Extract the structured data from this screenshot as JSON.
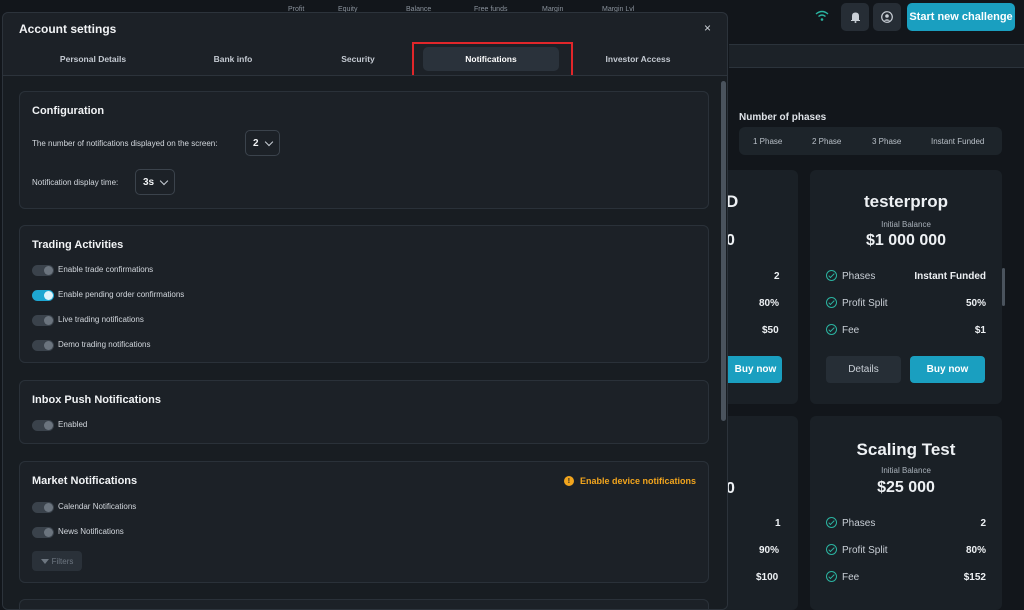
{
  "topbar": {
    "stats": [
      "Profit",
      "Equity",
      "Balance",
      "Free funds",
      "Margin",
      "Margin Lvl"
    ],
    "start_button": "Start new challenge",
    "icons": [
      "wifi-icon",
      "bell-icon",
      "user-icon"
    ]
  },
  "phases": {
    "title": "Number of phases",
    "tabs": [
      "1 Phase",
      "2 Phase",
      "3 Phase",
      "Instant Funded"
    ]
  },
  "cards": [
    {
      "title": "testerprop",
      "subtitle": "Initial Balance",
      "amount": "$1 000 000",
      "rows": [
        {
          "label": "Phases",
          "value": "Instant Funded"
        },
        {
          "label": "Profit Split",
          "value": "50%"
        },
        {
          "label": "Fee",
          "value": "$1"
        }
      ],
      "details_label": "Details",
      "buy_label": "Buy now"
    },
    {
      "title": "Scaling Test",
      "subtitle": "Initial Balance",
      "amount": "$25 000",
      "rows": [
        {
          "label": "Phases",
          "value": "2"
        },
        {
          "label": "Profit Split",
          "value": "80%"
        },
        {
          "label": "Fee",
          "value": "$152"
        }
      ]
    }
  ],
  "left_cards": {
    "top_values": [
      "2",
      "80%",
      "$50"
    ],
    "top_buy_label": "Buy now",
    "bottom_values": [
      "1",
      "90%",
      "$100"
    ],
    "title_fragments": [
      "D",
      "0",
      "0"
    ]
  },
  "modal": {
    "title": "Account settings",
    "close": "×",
    "tabs": [
      "Personal Details",
      "Bank info",
      "Security",
      "Notifications",
      "Investor Access"
    ],
    "active_tab": "Notifications",
    "configuration": {
      "title": "Configuration",
      "count_label": "The number of notifications displayed on the screen:",
      "count_value": "2",
      "time_label": "Notification display time:",
      "time_value": "3s"
    },
    "trading": {
      "title": "Trading Activities",
      "toggles": [
        {
          "label": "Enable trade confirmations",
          "on": false
        },
        {
          "label": "Enable pending order confirmations",
          "on": true
        },
        {
          "label": "Live trading notifications",
          "on": false
        },
        {
          "label": "Demo trading notifications",
          "on": false
        }
      ]
    },
    "inbox": {
      "title": "Inbox Push Notifications",
      "toggles": [
        {
          "label": "Enabled",
          "on": false
        }
      ]
    },
    "market": {
      "title": "Market Notifications",
      "device_warning": "Enable device notifications",
      "warning_glyph": "!",
      "toggles": [
        {
          "label": "Calendar Notifications",
          "on": false
        },
        {
          "label": "News Notifications",
          "on": false
        }
      ],
      "filters_label": "Filters"
    }
  },
  "colors": {
    "accent": "#1a9fc0",
    "toggle_on": "#1ea7d2",
    "warning": "#f2a51d",
    "highlight": "#e1262a",
    "check": "#2bb3a0"
  }
}
